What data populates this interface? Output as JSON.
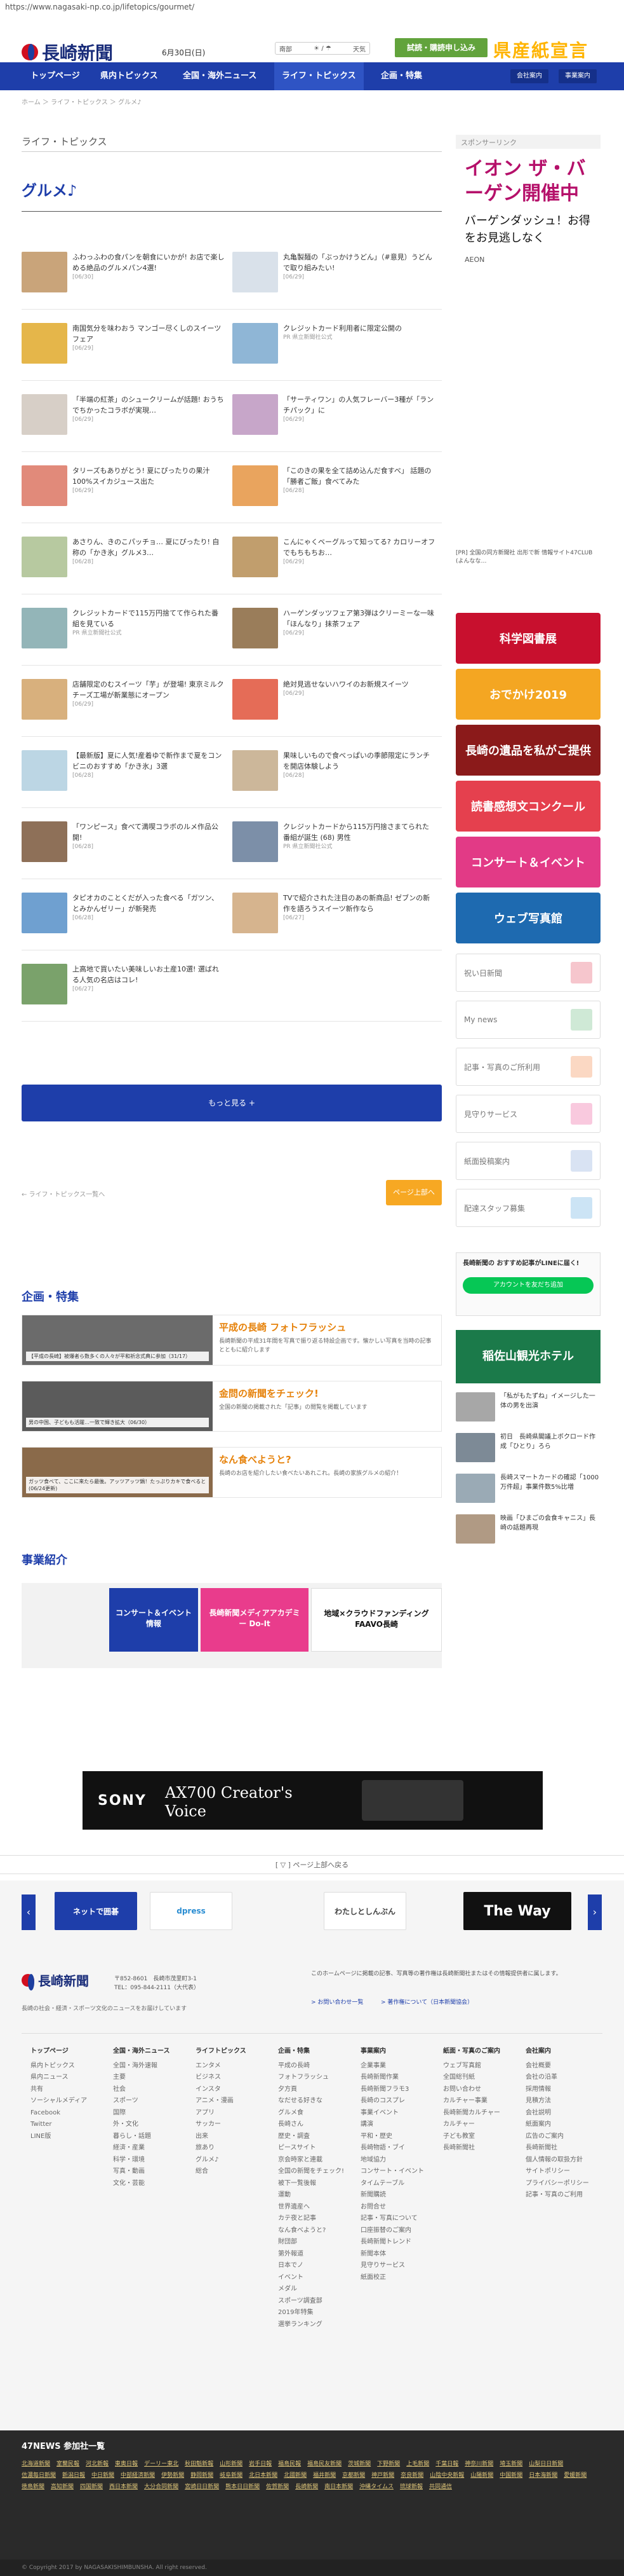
{
  "url": "https://www.nagasaki-np.co.jp/lifetopics/gourmet/",
  "header": {
    "logo": "長崎新聞",
    "date": "6月30日(日)",
    "weather": {
      "region": "南部",
      "tel": "☎",
      "cta": "天気"
    },
    "trial_button": "試読・購読申し込み",
    "banner": "県産紙宣言"
  },
  "nav": {
    "items": [
      "トップページ",
      "県内トピックス",
      "全国・海外ニュース",
      "ライフ・トピックス",
      "企画・特集"
    ],
    "right": [
      "会社案内",
      "事業案内"
    ]
  },
  "breadcrumb": "ホーム ＞ ライフ・トピックス ＞ グルメ♪",
  "section_title": "ライフ・トピックス",
  "category_title": "グルメ♪",
  "articles": [
    {
      "title": "ふわっふわの食パンを朝食にいかが! お店で楽しめる絶品のグルメパン4選!",
      "date": "[06/30]",
      "thumb": "#c9a47a"
    },
    {
      "title": "丸亀製麺の「ぶっかけうどん」（#意見）うどんで取り組みたい!",
      "date": "[06/29]",
      "thumb": "#d9e1ea"
    },
    {
      "title": "南国気分を味わおう マンゴー尽くしのスイーツフェア",
      "date": "[06/29]",
      "thumb": "#e5b64a"
    },
    {
      "title": "クレジットカード利用者に限定公開の",
      "date": "PR 県立新聞社公式",
      "thumb": "#8fb6d6"
    },
    {
      "title": "「半端の紅茶」のシュークリームが話題! おうちでちかったコラボが実現…",
      "date": "[06/29]",
      "thumb": "#d7cfc7"
    },
    {
      "title": "「サーティワン」の人気フレーバー3種が「ランチパック」に",
      "date": "[06/29]",
      "thumb": "#c7a6c9"
    },
    {
      "title": "タリーズもありがとう! 夏にぴったりの果汁100%スイカジュース出た",
      "date": "[06/29]",
      "thumb": "#e18a7a"
    },
    {
      "title": "「このきの果を全て詰め込んだ食すべ」 話題の「勝者ご飯」食べてみた",
      "date": "[06/28]",
      "thumb": "#e9a45e"
    },
    {
      "title": "あさりん、きのこパッチョ… 夏にぴったり! 自称の「かき氷」グルメ3…",
      "date": "[06/28]",
      "thumb": "#b7c9a0"
    },
    {
      "title": "こんにゃくベーグルって知ってる? カロリーオフでもちもちお…",
      "date": "[06/29]",
      "thumb": "#c19e6d"
    },
    {
      "title": "クレジットカードで115万円捨てて作られた番組を見ている",
      "date": "PR 県立新聞社公式",
      "thumb": "#93b5b8"
    },
    {
      "title": "ハーゲンダッツフェア第3弾はクリーミーな一味「ほんなり」抹茶フェア",
      "date": "[06/29]",
      "thumb": "#9a7d5a"
    },
    {
      "title": "店舗限定のむスイーツ「芋」が登場! 東京ミルクチーズ工場が新業態にオープン",
      "date": "[06/29]",
      "thumb": "#d8b07d"
    },
    {
      "title": "絶対見逃せないハワイのお新規スイーツ",
      "date": "[06/29]",
      "thumb": "#e56c57"
    },
    {
      "title": "【最新版】夏に人気!産着ゆで新作まで夏をコンビニのおすすめ「かき氷」3選",
      "date": "[06/28]",
      "thumb": "#bcd6e4"
    },
    {
      "title": "果味しいもので食べっぱいの季節限定にランチを開店体験しよう",
      "date": "[06/28]",
      "thumb": "#ccb79a"
    },
    {
      "title": "「ワンピース」食べて満喫コラボのルメ作品公開!",
      "date": "[06/28]",
      "thumb": "#8e7058"
    },
    {
      "title": "クレジットカードから115万円捨さまてられた番組が誕生 (68) 男性",
      "date": "PR 県立新聞社公式",
      "thumb": "#7c8fa8"
    },
    {
      "title": "タピオカのことくだが入った食べる「ガツン、とみかんゼリー」が新発売",
      "date": "[06/28]",
      "thumb": "#6fa0d0"
    },
    {
      "title": "TVで紹介された注目のあの新商品! ゼブンの新作を語ろうスイーツ新作なら",
      "date": "[06/27]",
      "thumb": "#d6b48e"
    },
    {
      "title": "上高地で買いたい美味しいお土産10選! 選ばれる人気の名店はコレ!",
      "date": "[06/27]",
      "thumb": "#7aa26b"
    }
  ],
  "more_button": "もっと見る +",
  "prev_link": "← ライフ・トピックス一覧へ",
  "page_top": "ページ上部へ",
  "kikaku_title": "企画・特集",
  "features": [
    {
      "title": "平成の長崎 フォトフラッシュ",
      "desc": "長崎新聞の平成31年間を写真で振り返る特設企画です。懐かしい写真を当時の記事とともに紹介します",
      "caption": "【平成の長崎】被爆者ら数多くの人々が平和祈念式典に参加（31/17）",
      "img": "#6b6b6b"
    },
    {
      "title": "金問の新聞をチェック!",
      "desc": "全国の新聞の掲載された「記事」の閲覧を掲載しています",
      "caption": "男の中国、子どもも活躍…一致で輝き拡大（06/30）",
      "img": "#5b5b5b"
    },
    {
      "title": "なん食べようと?",
      "desc": "長崎のお店を紹介したい食べたいあれこれ。長崎の家族グルメの紹介！",
      "caption": "ガッツ食べて、ここに来たら最後。アッツアッツ鍋！たっぷりカキで食べると(06/24更新)",
      "img": "#8a6a4a"
    }
  ],
  "biz_title": "事業紹介",
  "biz_banners": [
    "コンサート＆イベント情報",
    "長崎新聞メディアアカデミー Do-It",
    "地域×クラウドファンディング FAAVO長崎"
  ],
  "sidebar": {
    "sponsor_label": "スポンサーリンク",
    "aeon_headline": "イオン ザ・バーゲン開催中",
    "aeon_sub": "バーゲンダッシュ！お得をお見逃しなく",
    "aeon_brand": "AEON",
    "pr_news": "[PR] 全国の同方新聞社 出形で新 情報サイト47CLUB (よんなな…",
    "links": [
      "祝い日新聞",
      "My news",
      "記事・写真のご所利用",
      "見守りサービス",
      "紙面投稿案内",
      "配達スタッフ募集"
    ],
    "banners": [
      "科学図書展",
      "おでかけ2019",
      "長崎の遺品を私がご提供",
      "読書感想文コンクール",
      "コンサート＆イベント",
      "ウェブ写真館"
    ],
    "line_title": "長崎新聞の おすすめ記事がLINEに届く!",
    "line_button": "アカウントを友だち追加",
    "hotel": "稲佐山観光ホテル",
    "side_news": [
      "「私がもたずね」イメージした一体の男を出演",
      "初日　長崎県閣議上ボクロード作成「ひとり」ろら",
      "長崎スマートカードの確認「1000万件超」事業件数5%比増",
      "映画「ひまごの会食キャニス」長崎の話題再現"
    ]
  },
  "ad": {
    "brand": "SONY",
    "title": "AX700 Creator's Voice"
  },
  "ad_toggle": "[ ▽ ] ページ上部へ戻る",
  "carousel": [
    "ネットで囲碁",
    "dpress",
    "わたしとしんぶん",
    "The Way"
  ],
  "footer": {
    "logo": "長崎新聞",
    "address": "〒852-8601　長崎市茂里町3-1",
    "tel": "TEL：095-844-2111（大代表）",
    "tagline": "長崎の社会・経済・スポーツ文化のニュースをお届けしています",
    "notice": "このホームページに掲載の記事、写真等の著作権は長崎新聞社またはその情報提供者に属します。",
    "links": [
      "> お問い合わせ一覧",
      "> 著作権について（日本新聞協会）"
    ],
    "columns": [
      {
        "head": "トップページ",
        "items": [
          "県内トピックス",
          "県内ニュース",
          "共有",
          "ソーシャルメディア",
          "Facebook",
          "Twitter",
          "LINE版"
        ]
      },
      {
        "head": "全国・海外ニュース",
        "items": [
          "全国・海外速報",
          "主要",
          "社会",
          "スポーツ",
          "国際",
          "外・文化",
          "暮らし・話題",
          "経済・産業",
          "科学・環境",
          "写真・動画",
          "文化・芸能"
        ]
      },
      {
        "head": "ライフトピックス",
        "items": [
          "エンタメ",
          "ビジネス",
          "インスタ",
          "アニメ・漫画",
          "アプリ",
          "サッカー",
          "出来",
          "旅あり",
          "グルメ♪",
          "総合"
        ]
      },
      {
        "head": "企画・特集",
        "items": [
          "平成の長崎",
          "フォトフラッシュ",
          "夕方頁",
          "なだせる好きな",
          "グルメ食",
          "長崎さん",
          "歴史・調査",
          "ピースサイト",
          "京会時家と連載",
          "全国の新聞をチェック!",
          "被下一覧後報",
          "運動",
          "世界遺産へ",
          "カテ夜と記事",
          "なん食べようと?",
          "財団部",
          "第外報道",
          "日本でノ",
          "イベント",
          "メダル",
          "スポーツ調査部",
          "2019年特集",
          "選挙ランキング"
        ]
      },
      {
        "head": "事業案内",
        "items": [
          "企業事業",
          "長崎新聞作業",
          "長崎新聞フラモ3",
          "長崎のコスプレ",
          "事業イベント",
          "講演",
          "平和・歴史",
          "長崎物語・ブイ",
          "地域協力",
          "コンサート・イベント",
          "タイムテーブル",
          "新聞購読",
          "お問合せ",
          "記事・写真について",
          "口座振替のご案内",
          "長崎新聞トレンド",
          "新聞本体",
          "見守りサービス",
          "紙面校正"
        ]
      },
      {
        "head": "紙面・写真のご案内",
        "items": [
          "ウェブ写真館",
          "全国総刊紙",
          "お問い合わせ",
          "カルチャー事業",
          "長崎新聞カルチャー",
          "カルチャー",
          "子ども教室",
          "長崎新聞社"
        ]
      },
      {
        "head": "会社案内",
        "items": [
          "会社概要",
          "会社の沿革",
          "採用情報",
          "見積方法",
          "会社説明",
          "紙面案内",
          "広告のご案内",
          "長崎新聞社",
          "個人情報の取扱方針",
          "サイトポリシー",
          "プライバシーポリシー",
          "記事・写真のご利用"
        ]
      }
    ]
  },
  "f47": {
    "title": "47NEWS 参加社一覧",
    "papers": [
      "北海道新聞",
      "室蘭民報",
      "河北新報",
      "東奥日報",
      "デーリー東北",
      "秋田魁新報",
      "山形新聞",
      "岩手日報",
      "福島民報",
      "福島民友新聞",
      "茨城新聞",
      "下野新聞",
      "上毛新聞",
      "千葉日報",
      "神奈川新聞",
      "埼玉新聞",
      "山梨日日新聞",
      "信濃毎日新聞",
      "新潟日報",
      "中日新聞",
      "中部経済新聞",
      "伊勢新聞",
      "静岡新聞",
      "岐阜新聞",
      "北日本新聞",
      "北國新聞",
      "福井新聞",
      "京都新聞",
      "神戸新聞",
      "奈良新聞",
      "山陰中央新報",
      "山陽新聞",
      "中国新聞",
      "日本海新聞",
      "愛媛新聞",
      "徳島新聞",
      "高知新聞",
      "四国新聞",
      "西日本新聞",
      "大分合同新聞",
      "宮崎日日新聞",
      "熊本日日新聞",
      "佐賀新聞",
      "長崎新聞",
      "南日本新聞",
      "沖縄タイムス",
      "琉球新報",
      "共同通信"
    ]
  },
  "copyright": "© Copyright 2017 by NAGASAKISHIMBUNSHA. All right reserved."
}
